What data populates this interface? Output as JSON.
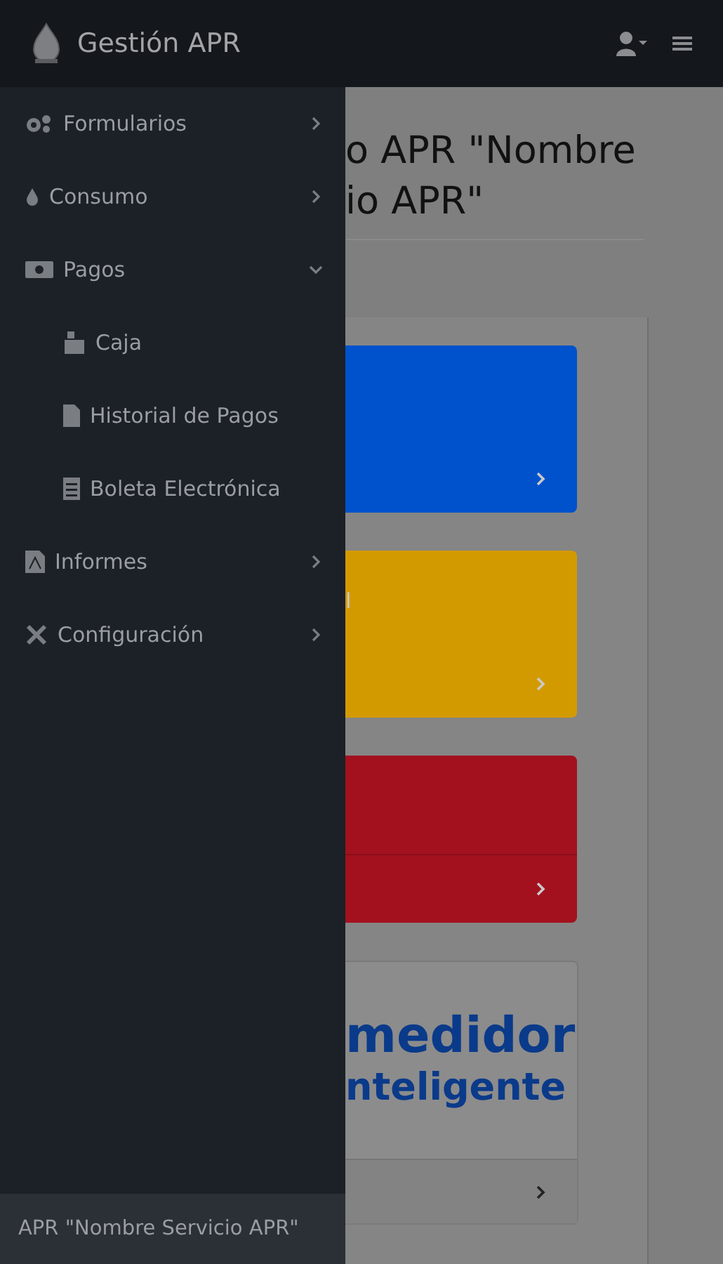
{
  "navbar": {
    "brand": "Gestión APR"
  },
  "sidebar": {
    "items": [
      {
        "label": "Formularios",
        "expanded": false
      },
      {
        "label": "Consumo",
        "expanded": false
      },
      {
        "label": "Pagos",
        "expanded": true,
        "children": [
          {
            "label": "Caja"
          },
          {
            "label": "Historial de Pagos"
          },
          {
            "label": "Boleta Electrónica"
          }
        ]
      },
      {
        "label": "Informes",
        "expanded": false
      },
      {
        "label": "Configuración",
        "expanded": false
      }
    ],
    "footer": "APR \"Nombre Servicio APR\""
  },
  "main": {
    "title_lines": [
      "o APR \"Nombre",
      "io APR\""
    ],
    "cards": [
      {
        "kind": "color",
        "color": "#0052cc",
        "divider": false
      },
      {
        "kind": "color",
        "color": "#d39a00",
        "divider": false,
        "text": "l"
      },
      {
        "kind": "color",
        "color": "#a3111e",
        "divider": true
      },
      {
        "kind": "promo",
        "lines": [
          "medidor",
          "nteligente"
        ]
      }
    ]
  }
}
